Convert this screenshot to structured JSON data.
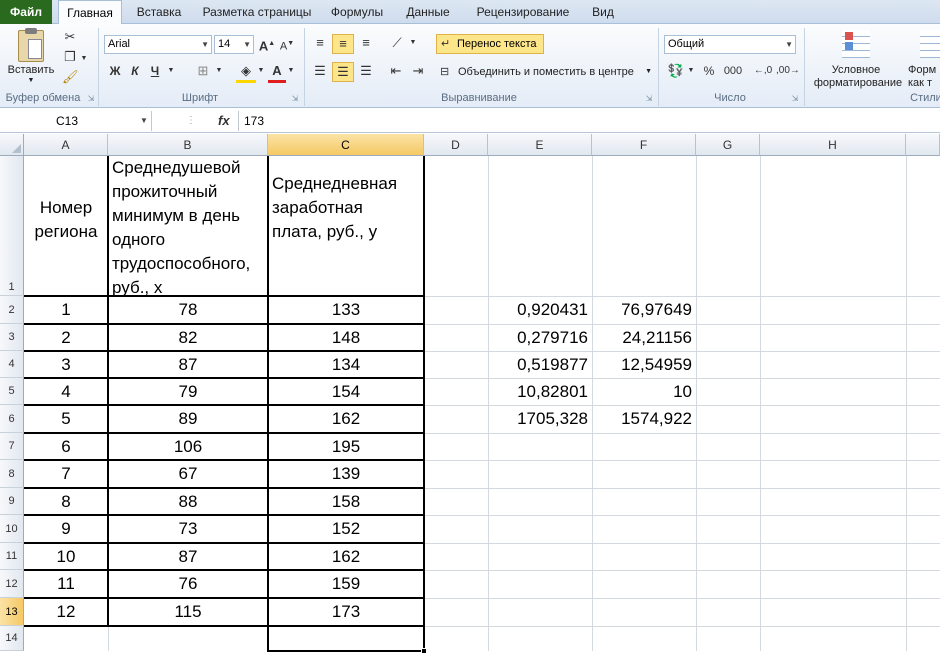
{
  "tabs": {
    "file": "Файл",
    "home": "Главная",
    "insert": "Вставка",
    "layout": "Разметка страницы",
    "formulas": "Формулы",
    "data": "Данные",
    "review": "Рецензирование",
    "view": "Вид"
  },
  "ribbon": {
    "paste": "Вставить",
    "clipboard_group": "Буфер обмена",
    "font_name": "Arial",
    "font_size": "14",
    "bold": "Ж",
    "italic": "К",
    "underline": "Ч",
    "font_group": "Шрифт",
    "wrap_text": "Перенос текста",
    "merge_center": "Объединить и поместить в центре",
    "alignment_group": "Выравнивание",
    "number_format": "Общий",
    "percent": "%",
    "thousands": "000",
    "number_group": "Число",
    "cond_format_1": "Условное",
    "cond_format_2": "форматирование",
    "format_table_1": "Форм",
    "format_table_2": "как т",
    "styles_group": "Стили"
  },
  "formula_bar": {
    "name_box": "C13",
    "fx": "fx",
    "content": "173"
  },
  "columns": [
    "A",
    "B",
    "C",
    "D",
    "E",
    "F",
    "G",
    "H"
  ],
  "rows": [
    "1",
    "2",
    "3",
    "4",
    "5",
    "6",
    "7",
    "8",
    "9",
    "10",
    "11",
    "12",
    "13",
    "14"
  ],
  "headers": {
    "a": [
      "Номер",
      "региона"
    ],
    "b": [
      "Среднедушевой",
      "прожиточный",
      "минимум в день",
      "одного",
      "трудоспособного,",
      "руб., x"
    ],
    "c": [
      "Среднедневная",
      "заработная",
      "плата, руб., y"
    ]
  },
  "table": [
    {
      "n": "1",
      "x": "78",
      "y": "133"
    },
    {
      "n": "2",
      "x": "82",
      "y": "148"
    },
    {
      "n": "3",
      "x": "87",
      "y": "134"
    },
    {
      "n": "4",
      "x": "79",
      "y": "154"
    },
    {
      "n": "5",
      "x": "89",
      "y": "162"
    },
    {
      "n": "6",
      "x": "106",
      "y": "195"
    },
    {
      "n": "7",
      "x": "67",
      "y": "139"
    },
    {
      "n": "8",
      "x": "88",
      "y": "158"
    },
    {
      "n": "9",
      "x": "73",
      "y": "152"
    },
    {
      "n": "10",
      "x": "87",
      "y": "162"
    },
    {
      "n": "11",
      "x": "76",
      "y": "159"
    },
    {
      "n": "12",
      "x": "115",
      "y": "173"
    }
  ],
  "regression": [
    {
      "e": "0,920431",
      "f": "76,97649"
    },
    {
      "e": "0,279716",
      "f": "24,21156"
    },
    {
      "e": "0,519877",
      "f": "12,54959"
    },
    {
      "e": "10,82801",
      "f": "10"
    },
    {
      "e": "1705,328",
      "f": "1574,922"
    }
  ],
  "selected_cell": "C13"
}
